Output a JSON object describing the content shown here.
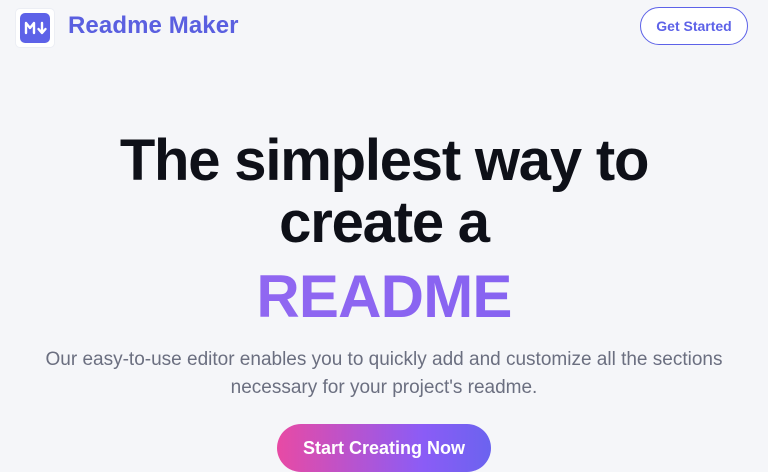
{
  "header": {
    "logo_icon": "markdown-icon",
    "brand_name": "Readme Maker",
    "get_started_label": "Get Started"
  },
  "hero": {
    "title_line1": "The simplest way to",
    "title_line2": "create a",
    "title_accent": "README",
    "subtitle": "Our easy-to-use editor enables you to quickly add and customize all the sections necessary for your project's readme.",
    "cta_label": "Start Creating Now"
  },
  "colors": {
    "brand": "#5d62e8",
    "accent_gradient_start": "#9b6cf2",
    "accent_gradient_end": "#7c5ef0",
    "cta_gradient_start": "#e84aa4",
    "cta_gradient_end": "#6b63ef",
    "background": "#f5f6f9"
  }
}
